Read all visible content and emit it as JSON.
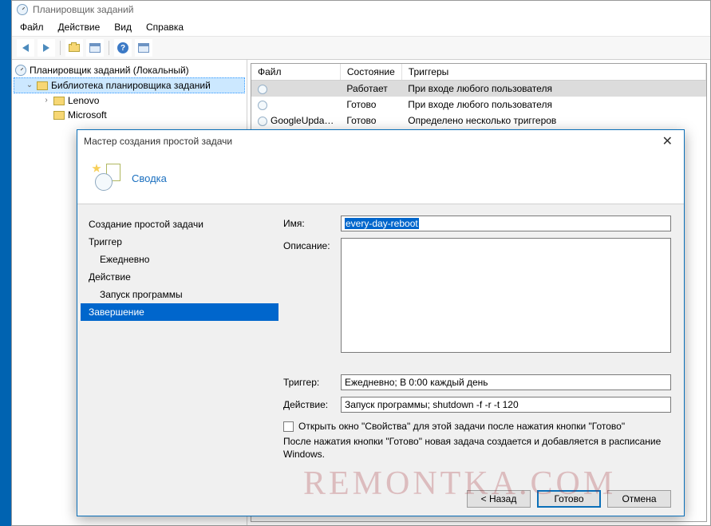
{
  "window": {
    "title": "Планировщик заданий",
    "menus": {
      "file": "Файл",
      "action": "Действие",
      "view": "Вид",
      "help": "Справка"
    }
  },
  "tree": {
    "root": "Планировщик заданий (Локальный)",
    "library": "Библиотека планировщика заданий",
    "children": {
      "lenovo": "Lenovo",
      "microsoft": "Microsoft"
    }
  },
  "table": {
    "headers": {
      "file": "Файл",
      "state": "Состояние",
      "triggers": "Триггеры"
    },
    "rows": [
      {
        "file": "",
        "state": "Работает",
        "trigger": "При входе любого пользователя"
      },
      {
        "file": "",
        "state": "Готово",
        "trigger": "При входе любого пользователя"
      },
      {
        "file": "GoogleUpda…",
        "state": "Готово",
        "trigger": "Определено несколько триггеров"
      }
    ]
  },
  "dialog": {
    "title": "Мастер создания простой задачи",
    "heading": "Сводка",
    "steps": {
      "create": "Создание простой задачи",
      "trigger": "Триггер",
      "daily": "Ежедневно",
      "action": "Действие",
      "run": "Запуск программы",
      "finish": "Завершение"
    },
    "labels": {
      "name": "Имя:",
      "desc": "Описание:",
      "trigger": "Триггер:",
      "action": "Действие:"
    },
    "values": {
      "name": "every-day-reboot",
      "trigger": "Ежедневно; В 0:00 каждый день",
      "action": "Запуск программы; shutdown -f -r -t 120"
    },
    "checkbox": "Открыть окно \"Свойства\" для этой задачи после нажатия кнопки \"Готово\"",
    "note": "После нажатия кнопки \"Готово\" новая задача создается и добавляется в расписание Windows.",
    "buttons": {
      "back": "< Назад",
      "finish": "Готово",
      "cancel": "Отмена"
    }
  },
  "watermark": "REMONTKA.COM"
}
